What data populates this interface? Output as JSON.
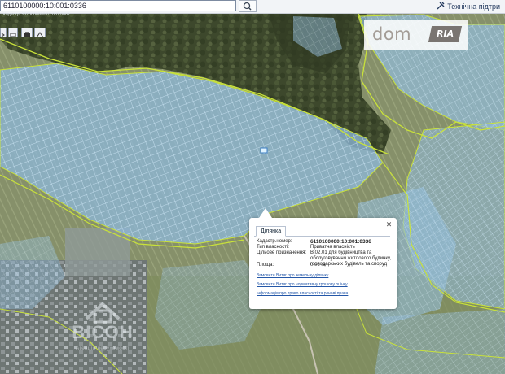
{
  "search": {
    "value": "6110100000:10:001:0336"
  },
  "header": {
    "tech_support": "Технічна підтри"
  },
  "coords_text": "Кадастр: 5370000000:07:087:0082",
  "logo": {
    "dom": "dom",
    "ria": "RIA"
  },
  "popup": {
    "tab": "Ділянка",
    "rows": [
      {
        "label": "Кадастр.номер:",
        "value": "6110100000:10:001:0336"
      },
      {
        "label": "Тип власності:",
        "value": "Приватна власність"
      },
      {
        "label": "Цільове призначення:",
        "value": "В.02.01 для будівництва та обслуговування житлового будинку, господарських будівель та споруд"
      },
      {
        "label": "Площа:",
        "value": "0.06 га"
      }
    ],
    "links": [
      "Замовити Витяг про земельну ділянку",
      "Замовити Витяг про нормативну грошову оцінку",
      "Інформація про право власності та речові права"
    ]
  },
  "watermark": {
    "title": "ВІСОН",
    "subtitle": "Агенція нерухомості"
  },
  "colors": {
    "forest": "#3e4a2e",
    "field": "#8a9468",
    "parcel_fill": "#8fb7d6",
    "parcel_stroke": "#bfe1f7",
    "boundary": "#c9e23a",
    "urban": "#6f7676"
  }
}
